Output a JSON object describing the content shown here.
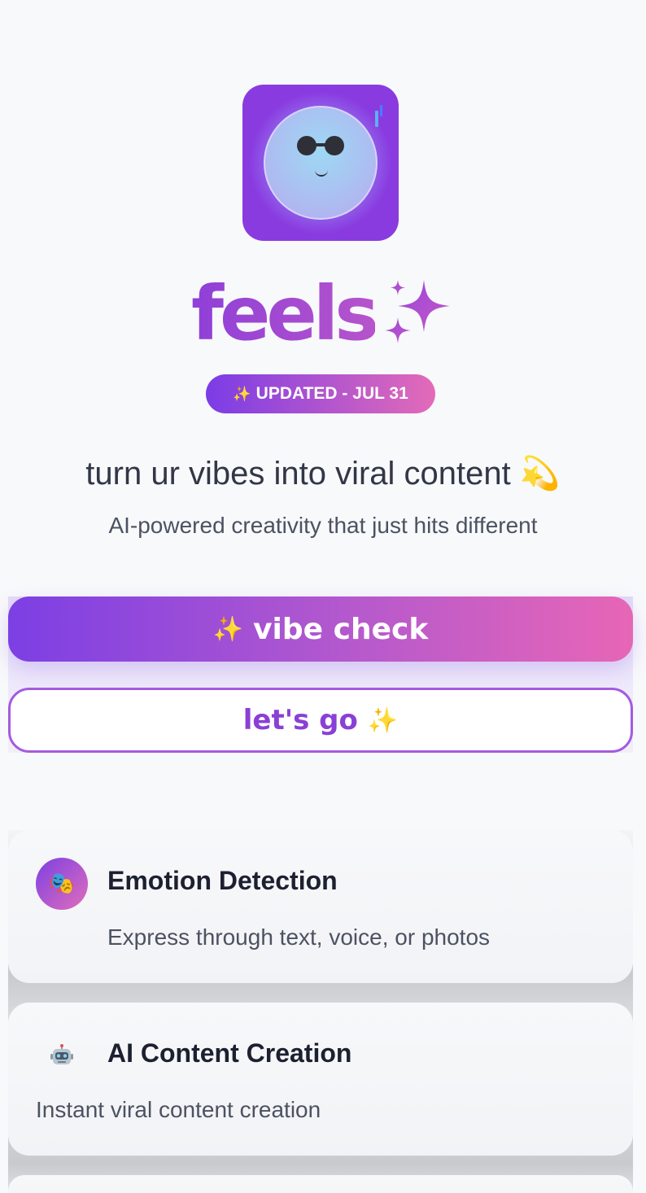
{
  "app": {
    "logo_text": "feels",
    "badge": "UPDATED - JUL 31",
    "badge_icon": "sparkles-icon"
  },
  "hero": {
    "headline": "turn ur vibes into viral content",
    "headline_emoji": "💫",
    "subline": "AI-powered creativity that just hits different"
  },
  "actions": {
    "primary_label": "vibe check",
    "primary_icon": "sparkles-icon",
    "secondary_label": "let's go",
    "secondary_icon": "sparkles-icon"
  },
  "features": [
    {
      "title": "Emotion Detection",
      "description": "Express through text, voice, or photos",
      "icon": "performing-arts-icon"
    },
    {
      "title": "AI Content Creation",
      "description": "Instant viral content creation",
      "icon": "robot-icon"
    }
  ],
  "colors": {
    "brand_purple": "#8a3be0",
    "brand_pink": "#e766b6",
    "text_dark": "#313746",
    "text_muted": "#4b5261"
  }
}
